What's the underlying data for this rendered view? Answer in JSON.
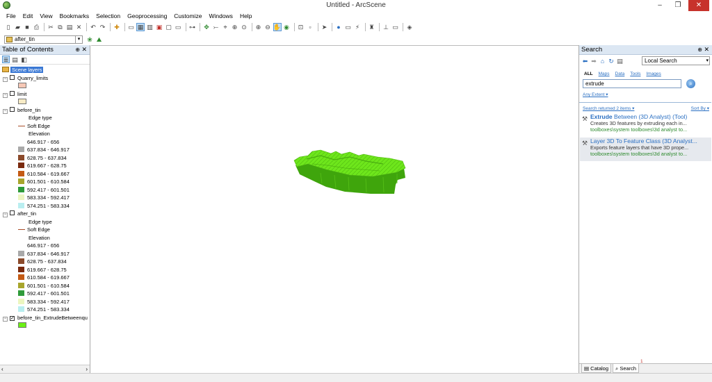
{
  "window": {
    "title": "Untitled - ArcScene",
    "minimize": "–",
    "restore": "❐",
    "close": "✕"
  },
  "menu": [
    "File",
    "Edit",
    "View",
    "Bookmarks",
    "Selection",
    "Geoprocessing",
    "Customize",
    "Windows",
    "Help"
  ],
  "toolbar": {
    "layer_select_value": "after_tin",
    "icons": [
      "new-icon",
      "open-icon",
      "save-icon",
      "print-icon",
      "cut-icon",
      "copy-icon",
      "paste-icon",
      "delete-icon",
      "undo-icon",
      "redo-icon",
      "add-data-icon",
      "navigate-icon",
      "zoom-in-icon",
      "zoom-out-icon",
      "pan-icon",
      "full-extent-icon",
      "select-icon",
      "identify-icon",
      "find-icon",
      "measure-icon"
    ]
  },
  "toc": {
    "title": "Table of Contents",
    "pin": "⊕",
    "close": "✕",
    "root": "Scene layers",
    "layers": [
      {
        "name": "Quarry_limits",
        "checked": false,
        "swatch_color": "#f6c8b6"
      },
      {
        "name": "limit",
        "checked": false,
        "swatch_color": "#f7ebc6"
      },
      {
        "name": "before_tin",
        "checked": false,
        "edge_heading": "Edge type",
        "edge_label": "Soft Edge",
        "elev_heading": "Elevation",
        "classes": [
          {
            "label": "646.917 - 656",
            "color": "#ffffff"
          },
          {
            "label": "637.834 - 646.917",
            "color": "#a9a9a9"
          },
          {
            "label": "628.75 - 637.834",
            "color": "#8b4a2b"
          },
          {
            "label": "619.667 - 628.75",
            "color": "#7a2a0e"
          },
          {
            "label": "610.584 - 619.667",
            "color": "#c45a14"
          },
          {
            "label": "601.501 - 610.584",
            "color": "#a8a52c"
          },
          {
            "label": "592.417 - 601.501",
            "color": "#2f9b3a"
          },
          {
            "label": "583.334 - 592.417",
            "color": "#ecf6c0"
          },
          {
            "label": "574.251 - 583.334",
            "color": "#b9eef0"
          }
        ]
      },
      {
        "name": "after_tin",
        "checked": false,
        "edge_heading": "Edge type",
        "edge_label": "Soft Edge",
        "elev_heading": "Elevation",
        "classes": [
          {
            "label": "646.917 - 656",
            "color": "#ffffff"
          },
          {
            "label": "637.834 - 646.917",
            "color": "#a9a9a9"
          },
          {
            "label": "628.75 - 637.834",
            "color": "#8b4a2b"
          },
          {
            "label": "619.667 - 628.75",
            "color": "#7a2a0e"
          },
          {
            "label": "610.584 - 619.667",
            "color": "#c45a14"
          },
          {
            "label": "601.501 - 610.584",
            "color": "#a8a52c"
          },
          {
            "label": "592.417 - 601.501",
            "color": "#2f9b3a"
          },
          {
            "label": "583.334 - 592.417",
            "color": "#ecf6c0"
          },
          {
            "label": "574.251 - 583.334",
            "color": "#b9eef0"
          }
        ]
      },
      {
        "name": "before_tin_ExtrudeBetweenqu",
        "checked": true,
        "swatch_color": "#6bf014"
      }
    ]
  },
  "search": {
    "title": "Search",
    "pin": "⊕",
    "close": "✕",
    "scope": "Local Search",
    "filters": [
      "ALL",
      "Maps",
      "Data",
      "Tools",
      "Images"
    ],
    "query": "extrude",
    "extent": "Any Extent ▾",
    "returned": "Search returned 2 items ▾",
    "sort_by": "Sort By ▾",
    "results": [
      {
        "title_bold": "Extrude",
        "title_rest": " Between (3D Analyst) (Tool)",
        "desc": "Creates 3D features by extruding each in...",
        "path": "toolboxes\\system toolboxes\\3d analyst to..."
      },
      {
        "title_bold": "",
        "title_rest": "Layer 3D To Feature Class (3D Analyst...",
        "desc": "Exports feature layers that have 3D prope...",
        "path": "toolboxes\\system toolboxes\\3d analyst to..."
      }
    ],
    "tabs": [
      "Catalog",
      "Search"
    ],
    "notification": "1"
  },
  "colors": {
    "extrusion_fill": "#6ee61c",
    "extrusion_shadow": "#3fa50c",
    "accent": "#2a6fc2"
  }
}
